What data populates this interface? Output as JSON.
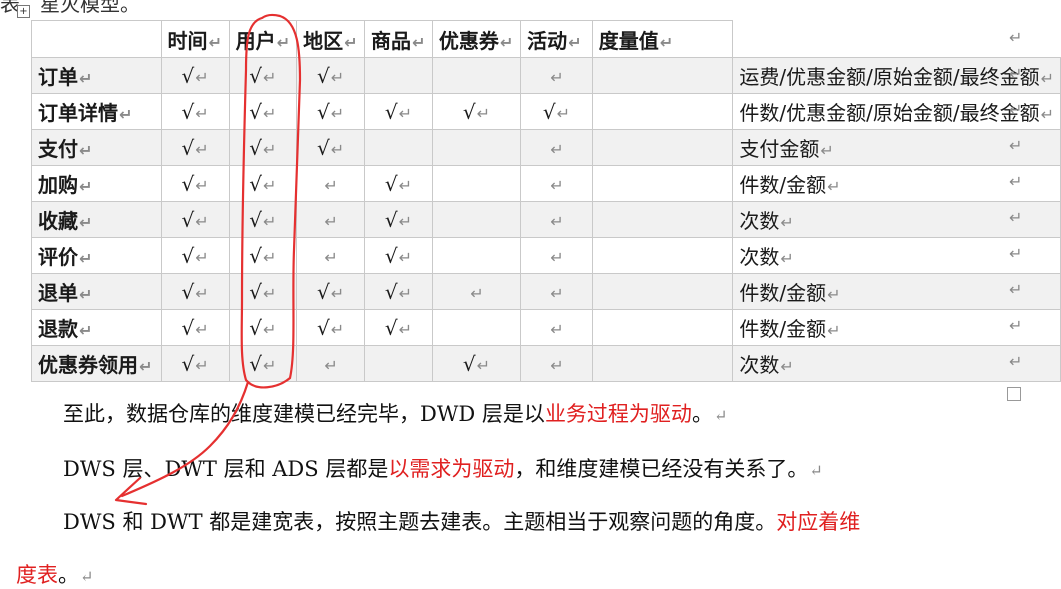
{
  "top_fragment": "表，星灭模型。",
  "para_mark": "↵",
  "check": "√",
  "table": {
    "headers": [
      "",
      "时间",
      "用户",
      "地区",
      "商品",
      "优惠券",
      "活动",
      "度量值"
    ],
    "rows": [
      {
        "name": "订单",
        "cells": [
          "√",
          "√",
          "√",
          "",
          "",
          "",
          ""
        ],
        "measure": "运费/优惠金额/原始金额/最终金额"
      },
      {
        "name": "订单详情",
        "cells": [
          "√",
          "√",
          "√",
          "√",
          "√",
          "√",
          ""
        ],
        "measure": "件数/优惠金额/原始金额/最终金额"
      },
      {
        "name": "支付",
        "cells": [
          "√",
          "√",
          "√",
          "",
          "",
          "",
          ""
        ],
        "measure": "支付金额"
      },
      {
        "name": "加购",
        "cells": [
          "√",
          "√",
          "",
          "√",
          "",
          "",
          ""
        ],
        "measure": "件数/金额"
      },
      {
        "name": "收藏",
        "cells": [
          "√",
          "√",
          "",
          "√",
          "",
          "",
          ""
        ],
        "measure": "次数"
      },
      {
        "name": "评价",
        "cells": [
          "√",
          "√",
          "",
          "√",
          "",
          "",
          ""
        ],
        "measure": "次数"
      },
      {
        "name": "退单",
        "cells": [
          "√",
          "√",
          "√",
          "√",
          "",
          "",
          ""
        ],
        "measure": "件数/金额"
      },
      {
        "name": "退款",
        "cells": [
          "√",
          "√",
          "√",
          "√",
          "",
          "",
          ""
        ],
        "measure": "件数/金额"
      },
      {
        "name": "优惠券领用",
        "cells": [
          "√",
          "√",
          "",
          "",
          "√",
          "",
          ""
        ],
        "measure": "次数"
      }
    ]
  },
  "paragraphs": {
    "p1": {
      "a": "至此，数据仓库的维度建模已经完毕，DWD 层是以",
      "red": "业务过程为驱动",
      "b": "。"
    },
    "p2": {
      "a": "DWS 层、DWT 层和 ADS 层都是",
      "red": "以需求为驱动",
      "b": "，和维度建模已经没有关系了。"
    },
    "p3": {
      "a": "DWS  和  DWT  都是建宽表，按照主题去建表。主题相当于观察问题的角度。",
      "red": "对应着维"
    },
    "p4": {
      "red": "度表",
      "b": "。"
    }
  },
  "annotation": {
    "color": "#e53030",
    "shape": "hand-drawn loop around 用户 column with arrow pointing to DWS paragraph"
  }
}
